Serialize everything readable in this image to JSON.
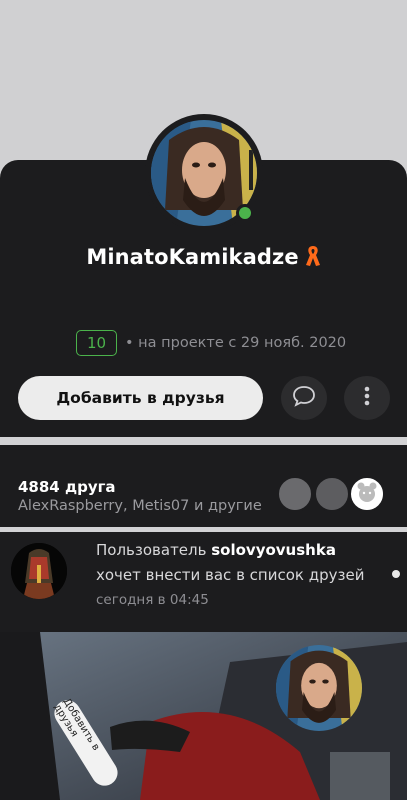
{
  "profile": {
    "username": "MinatoKamikadze",
    "level": "10",
    "member_since": "• на проекте с 29 нояб. 2020",
    "online": true
  },
  "actions": {
    "add_friend_label": "Добавить в друзья",
    "message_icon": "speech-bubble-icon",
    "more_icon": "vertical-dots-icon"
  },
  "friends": {
    "count_label": "4884 друга",
    "names_label": "AlexRaspberry, Metis07 и другие"
  },
  "notification": {
    "prefix": "Пользователь ",
    "user": "solovyovushka",
    "line2": "хочет внести вас в список друзей",
    "time": "сегодня в 04:45"
  },
  "banner": {
    "sticker_label": "Добавить в друзья"
  },
  "colors": {
    "accent_green": "#4bb34b",
    "card_bg": "#1c1c1e",
    "ribbon": "#ff6a1a"
  }
}
